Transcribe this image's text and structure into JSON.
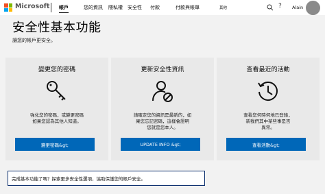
{
  "header": {
    "brand": "Microsoft",
    "nav": [
      "帳戶",
      "您的資訊",
      "隱私權",
      "安全性",
      "付款",
      "付款與帳單"
    ],
    "more": "其他",
    "user_name": "Alain",
    "logo_colors": [
      "#f25022",
      "#7fba00",
      "#00a4ef",
      "#ffb900"
    ]
  },
  "page": {
    "title": "安全性基本功能",
    "subtitle": "讓您的帳戶更安全。"
  },
  "cards": [
    {
      "title": "變更您的密碼",
      "icon": "key-icon",
      "description": "強化您的密碼，或變更密碼讓他人知道了。如果您認為其他人知道。",
      "description_lines": [
        "強化您的密碼，或變更密碼",
        "如果您認為其他人知道。"
      ],
      "button": "變更密碼&gt;"
    },
    {
      "title": "更新安全性資訊",
      "icon": "user-block-icon",
      "description_lines": [
        "請確定您的資訊是最新的，如",
        "果您忘記密碼，這樣會證明",
        "您就是您本人。"
      ],
      "button": "UPDATE INFO &gt;"
    },
    {
      "title": "查看最近的活動",
      "icon": "history-icon",
      "description_lines": [
        "查看您何時何地已登錄，",
        "新我們其中某些事是否",
        "異常。"
      ],
      "button": "查看活動&gt;"
    }
  ],
  "banner": {
    "text": "完成基本功能了嗎？探索更多安全性選項，協助保護您的帳戶安全。"
  },
  "colors": {
    "accent": "#0067b8",
    "banner_border": "#0b2e6e"
  }
}
